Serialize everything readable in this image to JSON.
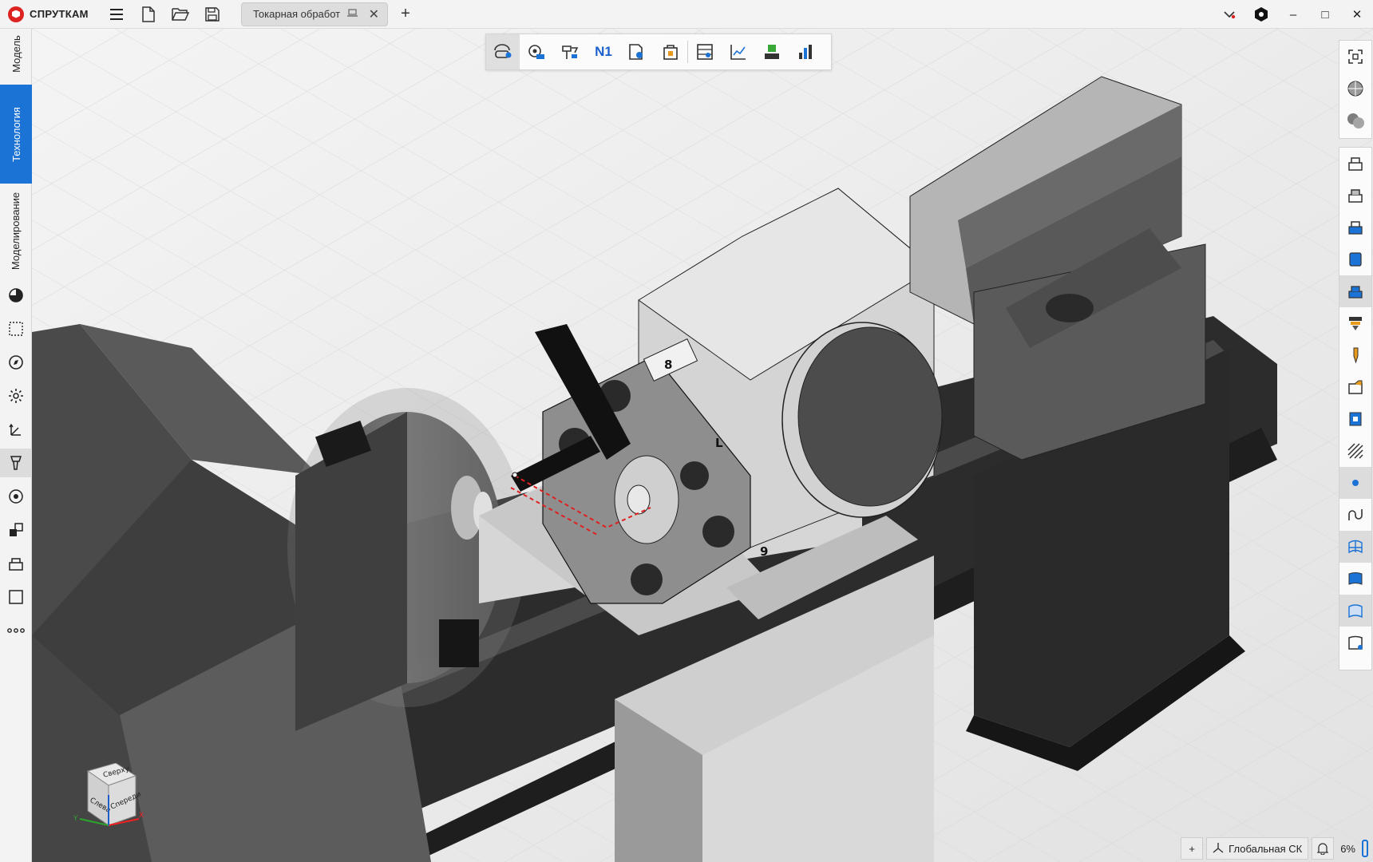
{
  "app": {
    "name": "СПРУТКАМ",
    "brand_color": "#d22222",
    "accent": "#1c73d6"
  },
  "titlebar": {
    "menu_icon": "hamburger-icon",
    "new_icon": "new-file-icon",
    "open_icon": "open-folder-icon",
    "save_icon": "save-icon",
    "tab_label": "Токарная обработ",
    "tab_icon": "laptop-icon",
    "new_tab": "+"
  },
  "window": {
    "minimize": "–",
    "maximize": "□",
    "close": "✕"
  },
  "left_tabs": [
    {
      "label": "Модель",
      "active": false
    },
    {
      "label": "Технология",
      "active": true
    },
    {
      "label": "Моделирование",
      "active": false
    }
  ],
  "left_icons": [
    "shading-icon",
    "selection-icon",
    "compass-icon",
    "settings-icon",
    "axes-icon",
    "tool-icon",
    "machine-icon",
    "transform-icon",
    "layers-icon",
    "frame-icon",
    "more-icon"
  ],
  "top_toolbar": [
    "simulation-icon",
    "tool-path-icon",
    "machine-setup-icon",
    "nc-code-icon",
    "postprocessor-icon",
    "report-icon",
    "table-icon",
    "chart-icon",
    "stock-icon",
    "statistics-icon"
  ],
  "top_toolbar_text": {
    "nc": "N1"
  },
  "right_toolbar_top": [
    "zoom-fit-icon",
    "sphere-shaded-icon",
    "spheres-icon"
  ],
  "right_toolbar_main": [
    "lathe-view-1-icon",
    "lathe-view-2-icon",
    "lathe-view-3-icon",
    "lathe-view-4-icon",
    "lathe-view-5-icon",
    "drill-holder-icon",
    "cutter-icon",
    "workpiece-icon",
    "fixture-icon",
    "hatch-icon",
    "point-icon",
    "curve-icon",
    "mesh-icon",
    "surface-icon",
    "solid-icon",
    "half-surface-icon"
  ],
  "scene_labels": {
    "jaw_top": "8",
    "jaw_right": "L",
    "jaw_bottom": "9"
  },
  "viewcube": {
    "top": "Сверху",
    "left": "Слева",
    "front": "Спереди",
    "axis_x": "X",
    "axis_y": "Y",
    "axis_z": "Z"
  },
  "status": {
    "coord_system": "Глобальная СК",
    "zoom": "6%",
    "add": "+",
    "bell_icon": "bell-icon",
    "cs_icon": "coordinate-system-icon"
  }
}
